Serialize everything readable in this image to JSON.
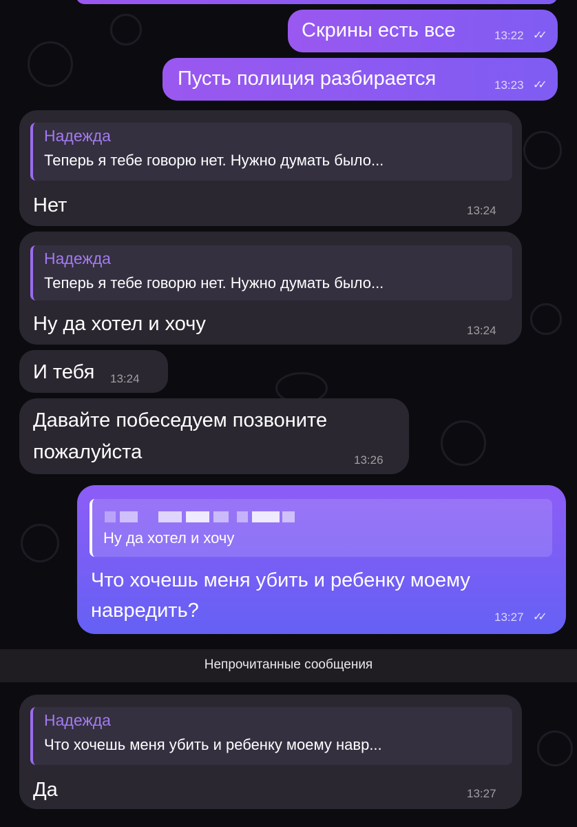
{
  "divider": {
    "label": "Непрочитанные сообщения"
  },
  "messages": [
    {
      "text": "Скрины есть все",
      "time": "13:22"
    },
    {
      "text": "Пусть полиция разбирается",
      "time": "13:23"
    },
    {
      "reply_name": "Надежда",
      "reply_text": "Теперь я тебе говорю нет. Нужно думать было...",
      "text": "Нет",
      "time": "13:24"
    },
    {
      "reply_name": "Надежда",
      "reply_text": "Теперь я тебе говорю нет. Нужно думать было...",
      "text": "Ну да хотел и хочу",
      "time": "13:24"
    },
    {
      "text": "И тебя",
      "time": "13:24"
    },
    {
      "text_line1": "Давайте побеседуем позвоните",
      "text_line2": "пожалуйста",
      "time": "13:26"
    },
    {
      "reply_text": "Ну да хотел и хочу",
      "text_line1": "Что хочешь меня убить и ребенку моему",
      "text_line2": "навредить?",
      "time": "13:27"
    },
    {
      "reply_name": "Надежда",
      "reply_text": "Что хочешь меня убить и ребенку моему навр...",
      "text": "Да",
      "time": "13:27"
    }
  ],
  "colors": {
    "incoming": "#2a2730",
    "outgoing": "#8a5cf4",
    "reply_name": "#a47af0",
    "background": "#0c0c10"
  },
  "icons": {
    "read_receipt": "double-check-icon"
  }
}
